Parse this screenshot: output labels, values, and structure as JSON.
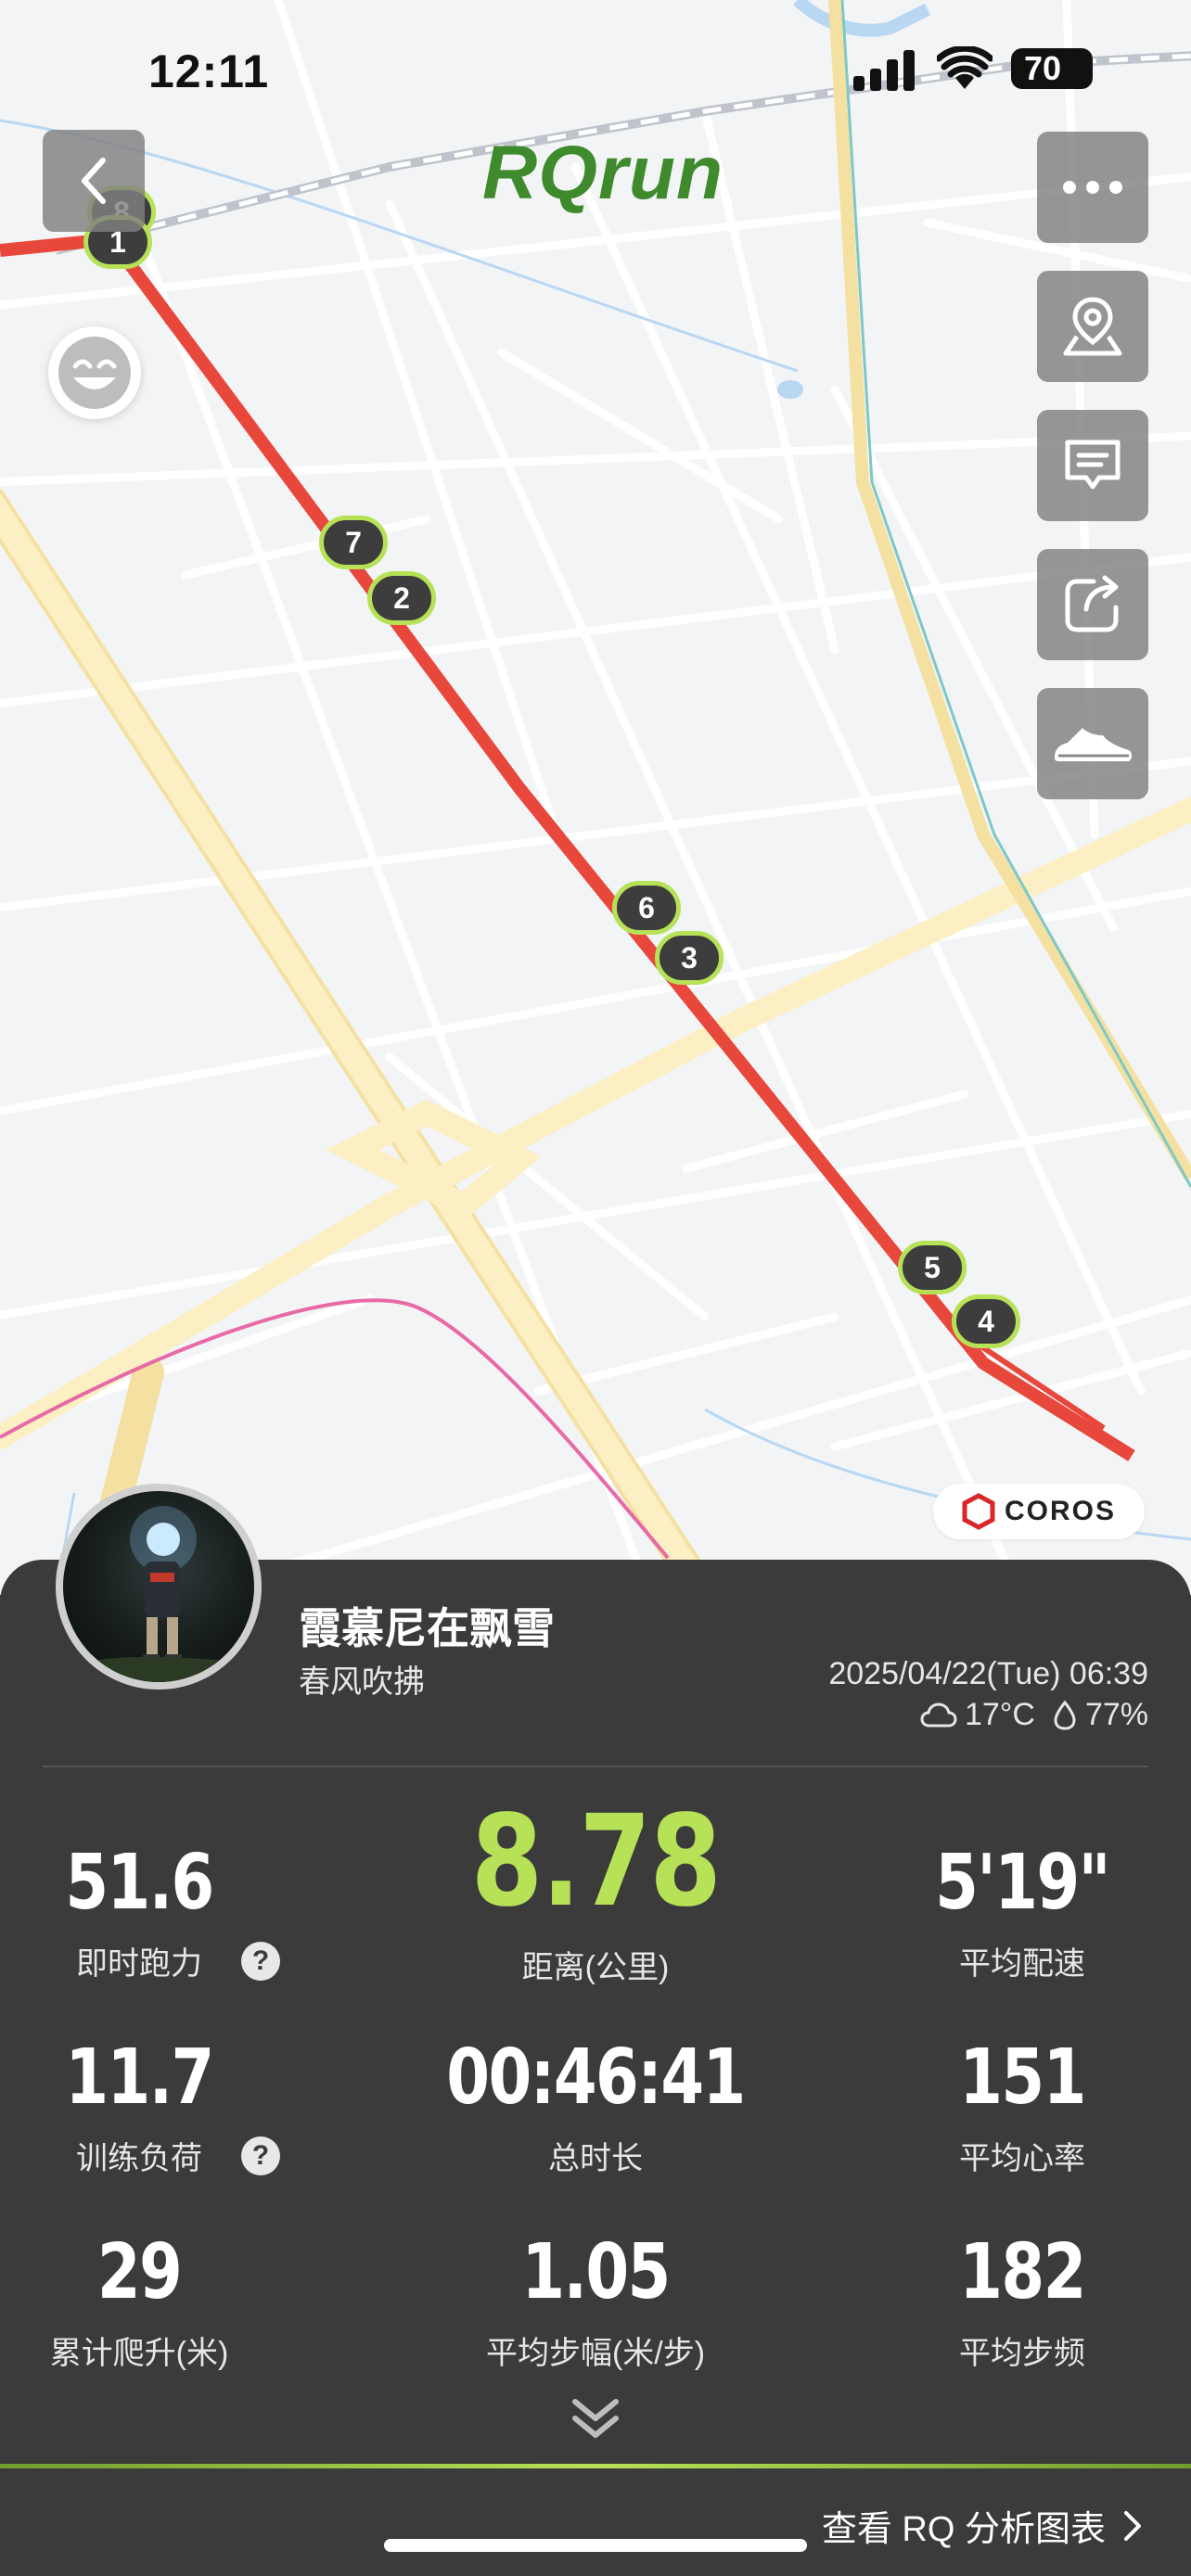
{
  "status_bar": {
    "time": "12:11",
    "battery": "70"
  },
  "brand": "RQrun",
  "map": {
    "lap_markers": [
      "8",
      "1",
      "7",
      "2",
      "6",
      "3",
      "5",
      "4"
    ],
    "watermark": "COROS",
    "colors": {
      "route": "#e53935",
      "marker_border": "#b7e157",
      "marker_fill": "#3d3d3d",
      "road_major": "#fbeab0"
    }
  },
  "right_toolbar": [
    "more-icon",
    "location-pin-icon",
    "comment-icon",
    "share-icon",
    "shoe-icon"
  ],
  "profile": {
    "name": "霞慕尼在飘雪",
    "subtitle": "春风吹拂",
    "datetime": "2025/04/22(Tue) 06:39",
    "temperature": "17°C",
    "humidity": "77%"
  },
  "stats": {
    "running_power": {
      "value": "51.6",
      "label": "即时跑力"
    },
    "distance": {
      "value": "8.78",
      "label": "距离(公里)"
    },
    "avg_pace": {
      "value": "5'19\"",
      "label": "平均配速"
    },
    "training_load": {
      "value": "11.7",
      "label": "训练负荷"
    },
    "total_time": {
      "value": "00:46:41",
      "label": "总时长"
    },
    "avg_hr": {
      "value": "151",
      "label": "平均心率"
    },
    "elevation_gain": {
      "value": "29",
      "label": "累计爬升(米)"
    },
    "avg_stride": {
      "value": "1.05",
      "label": "平均步幅(米/步)"
    },
    "avg_cadence": {
      "value": "182",
      "label": "平均步频"
    },
    "help_mark": "?"
  },
  "bottom_link": "查看 RQ 分析图表",
  "accent_color": "#b7e157"
}
